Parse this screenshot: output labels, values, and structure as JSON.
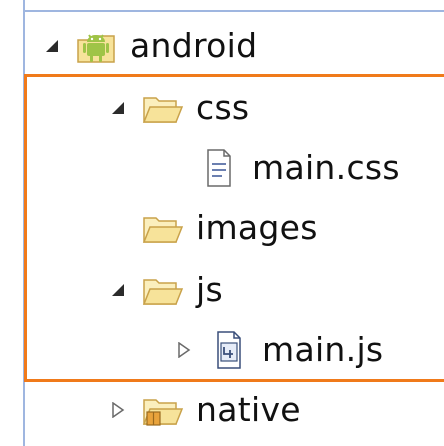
{
  "tree": {
    "items": [
      {
        "label": "android",
        "type": "project",
        "expanded": true,
        "icon": "android-project-icon"
      },
      {
        "label": "css",
        "type": "folder",
        "expanded": true,
        "icon": "folder-open-icon"
      },
      {
        "label": "main.css",
        "type": "file",
        "icon": "css-file-icon"
      },
      {
        "label": "images",
        "type": "folder",
        "icon": "folder-open-icon"
      },
      {
        "label": "js",
        "type": "folder",
        "expanded": true,
        "icon": "folder-open-icon"
      },
      {
        "label": "main.js",
        "type": "file",
        "expanded": false,
        "icon": "js-file-icon"
      },
      {
        "label": "native",
        "type": "folder",
        "expanded": false,
        "icon": "package-folder-icon"
      }
    ]
  },
  "colors": {
    "highlight_border": "#f07a1a",
    "tree_rule": "#9fb6e0",
    "folder_fill": "#f7e39a",
    "folder_stroke": "#c9a24a",
    "android_green": "#9fc447"
  }
}
